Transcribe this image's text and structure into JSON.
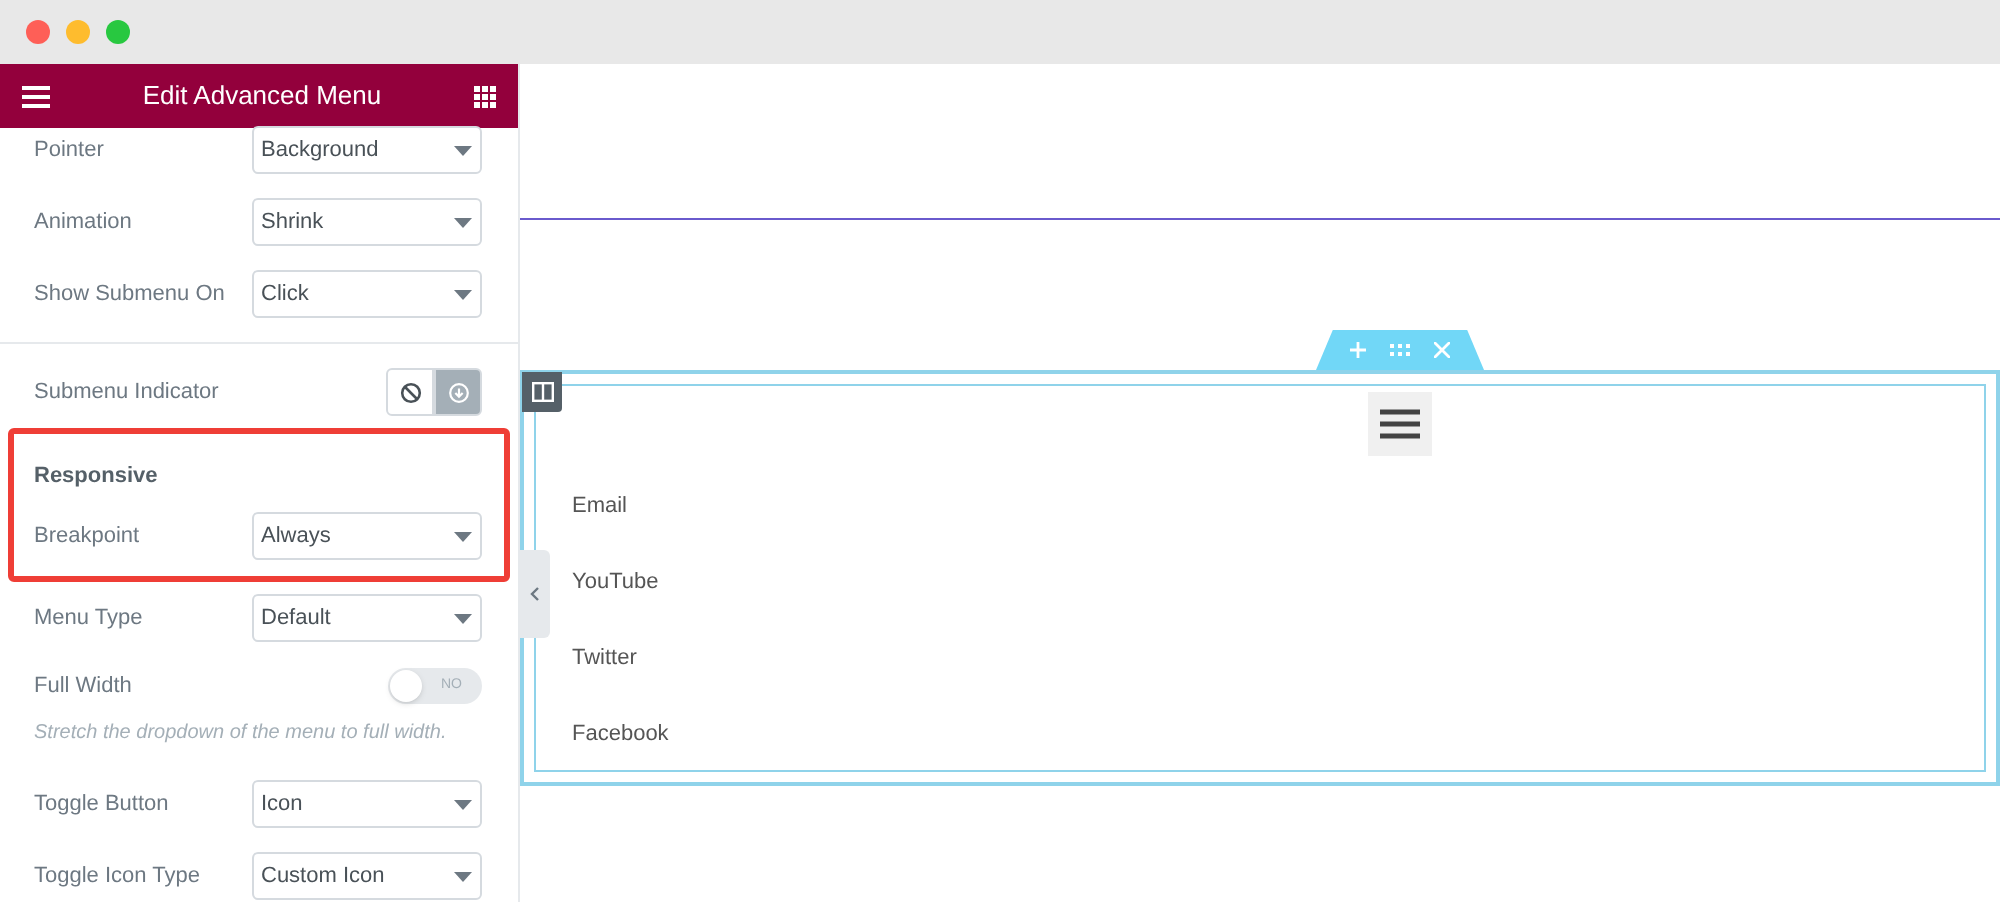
{
  "panel": {
    "title": "Edit Advanced Menu"
  },
  "sections": [
    {
      "highlighted": false,
      "controls": [
        {
          "kind": "select",
          "label": "Pointer",
          "value": "Background"
        },
        {
          "kind": "select",
          "label": "Animation",
          "value": "Shrink"
        },
        {
          "kind": "select",
          "label": "Show Submenu On",
          "value": "Click"
        }
      ]
    },
    {
      "highlighted": false,
      "controls": [
        {
          "kind": "choice",
          "label": "Submenu Indicator",
          "options": [
            {
              "selected": false
            },
            {
              "selected": true
            }
          ]
        }
      ]
    },
    {
      "highlighted": true,
      "heading": "Responsive",
      "controls": [
        {
          "kind": "select",
          "label": "Breakpoint",
          "value": "Always"
        }
      ]
    },
    {
      "highlighted": false,
      "controls": [
        {
          "kind": "select",
          "label": "Menu Type",
          "value": "Default"
        },
        {
          "kind": "toggle",
          "label": "Full Width",
          "on": false,
          "state_text": "NO"
        },
        {
          "kind": "note",
          "label": "Stretch the dropdown of the menu to full width."
        },
        {
          "kind": "select",
          "label": "Toggle Button",
          "value": "Icon"
        },
        {
          "kind": "select",
          "label": "Toggle Icon Type",
          "value": "Custom Icon"
        }
      ]
    }
  ],
  "canvas": {
    "menu_items": [
      "Email",
      "YouTube",
      "Twitter",
      "Facebook"
    ]
  }
}
